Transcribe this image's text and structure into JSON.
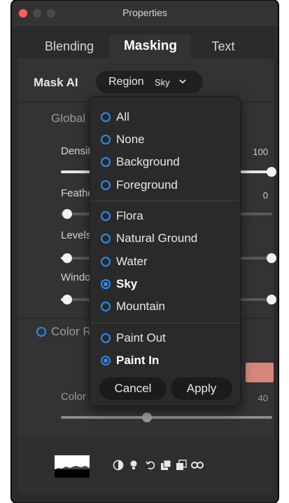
{
  "window": {
    "title": "Properties"
  },
  "tabs": [
    {
      "label": "Blending",
      "active": false
    },
    {
      "label": "Masking",
      "active": true
    },
    {
      "label": "Text",
      "active": false
    }
  ],
  "mask": {
    "label": "Mask AI",
    "region_button_label": "Region",
    "region_value": "Sky"
  },
  "global": {
    "title": "Global",
    "sliders": [
      {
        "label": "Density",
        "value": "100",
        "fraction": 1.0
      },
      {
        "label": "Feather",
        "value": "0",
        "fraction": 0.0
      },
      {
        "label": "Levels",
        "value": "",
        "fraction": 1.0
      },
      {
        "label": "Window",
        "value": "",
        "fraction": 1.0
      }
    ]
  },
  "color": {
    "title": "Color Range",
    "slider_label": "Color",
    "slider_value": "40",
    "slider_fraction": 0.4,
    "swatch_color": "#d7867a"
  },
  "footer": {
    "icons": [
      "invert-icon",
      "bulb-icon",
      "undo-icon",
      "copy-mask-icon",
      "paste-mask-icon",
      "link-icon"
    ]
  },
  "dropdown": {
    "groups": [
      [
        {
          "label": "All",
          "selected": false
        },
        {
          "label": "None",
          "selected": false
        },
        {
          "label": "Background",
          "selected": false
        },
        {
          "label": "Foreground",
          "selected": false
        }
      ],
      [
        {
          "label": "Flora",
          "selected": false
        },
        {
          "label": "Natural Ground",
          "selected": false
        },
        {
          "label": "Water",
          "selected": false
        },
        {
          "label": "Sky",
          "selected": true
        },
        {
          "label": "Mountain",
          "selected": false
        }
      ],
      [
        {
          "label": "Paint Out",
          "selected": false
        },
        {
          "label": "Paint In",
          "selected": true
        }
      ]
    ],
    "cancel_label": "Cancel",
    "apply_label": "Apply"
  },
  "colors": {
    "accent": "#2d8cf0",
    "window_bg": "#2b2b2b",
    "panel_bg": "#333333",
    "close_button": "#ff5f57"
  }
}
